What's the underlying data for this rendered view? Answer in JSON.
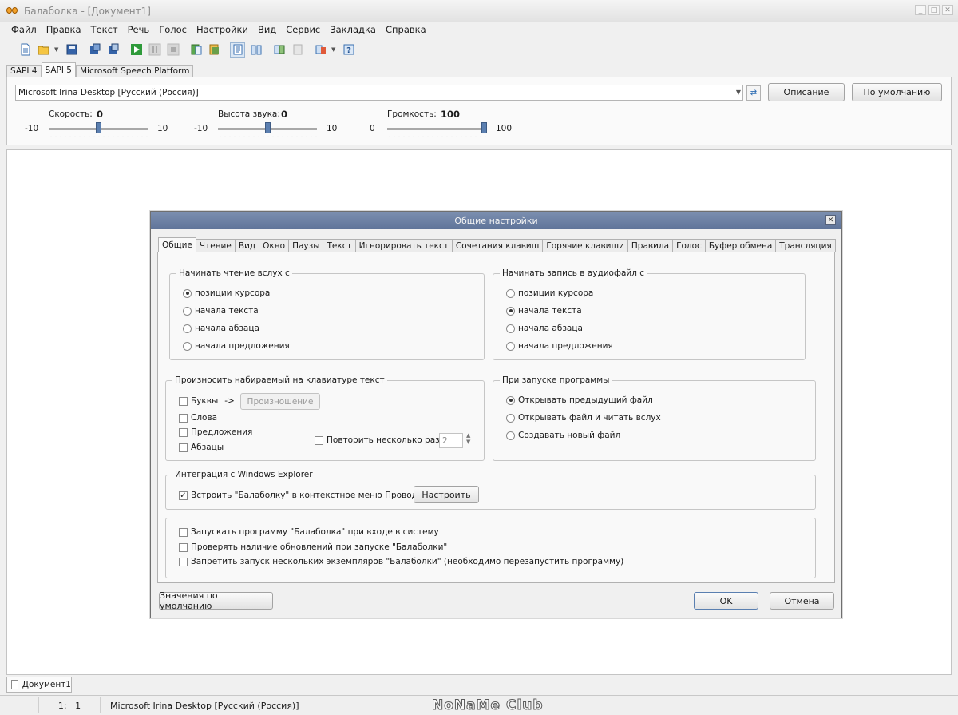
{
  "window": {
    "title": "Балаболка - [Документ1]"
  },
  "menu": [
    "Файл",
    "Правка",
    "Текст",
    "Речь",
    "Голос",
    "Настройки",
    "Вид",
    "Сервис",
    "Закладка",
    "Справка"
  ],
  "sapi_tabs": [
    "SAPI 4",
    "SAPI 5",
    "Microsoft Speech Platform"
  ],
  "voice": {
    "selected": "Microsoft Irina Desktop [Русский (Россия)]",
    "describe_label": "Описание",
    "default_label": "По умолчанию",
    "speed": {
      "label": "Скорость:",
      "value": "0",
      "min": "-10",
      "max": "10",
      "level": 0
    },
    "pitch": {
      "label": "Высота звука:",
      "value": "0",
      "min": "-10",
      "max": "10",
      "level": 0
    },
    "volume": {
      "label": "Громкость:",
      "value": "100",
      "min": "0",
      "max": "100",
      "level": 100
    }
  },
  "dialog": {
    "title": "Общие настройки",
    "tabs": [
      "Общие",
      "Чтение",
      "Вид",
      "Окно",
      "Паузы",
      "Текст",
      "Игнорировать текст",
      "Сочетания клавиш",
      "Горячие клавиши",
      "Правила",
      "Голос",
      "Буфер обмена",
      "Трансляция"
    ],
    "start_reading": {
      "legend": "Начинать чтение вслух с",
      "options": [
        "позиции курсора",
        "начала текста",
        "начала абзаца",
        "начала предложения"
      ],
      "selected": 0
    },
    "start_recording": {
      "legend": "Начинать запись в аудиофайл с",
      "options": [
        "позиции курсора",
        "начала текста",
        "начала абзаца",
        "начала предложения"
      ],
      "selected": 1
    },
    "typed_text": {
      "legend": "Произносить набираемый на клавиатуре текст",
      "letters": "Буквы",
      "arrow": "->",
      "pronunciation_button": "Произношение",
      "words": "Слова",
      "sentences": "Предложения",
      "paragraphs": "Абзацы",
      "repeat_label": "Повторить несколько раз:",
      "repeat_value": "2"
    },
    "on_start": {
      "legend": "При запуске программы",
      "options": [
        "Открывать предыдущий файл",
        "Открывать файл и читать вслух",
        "Создавать новый файл"
      ],
      "selected": 0
    },
    "explorer": {
      "legend": "Интеграция с Windows Explorer",
      "embed_label": "Встроить \"Балаболку\" в контекстное меню Проводника",
      "embed_checked": true,
      "configure_button": "Настроить"
    },
    "misc": [
      "Запускать программу \"Балаболка\" при входе в систему",
      "Проверять наличие обновлений при запуске \"Балаболки\"",
      "Запретить запуск нескольких экземпляров \"Балаболки\" (необходимо перезапустить программу)"
    ],
    "defaults_button": "Значения по умолчанию",
    "ok_button": "OK",
    "cancel_button": "Отмена"
  },
  "document_tab": "Документ1",
  "status": {
    "position": "1:   1",
    "voice": "Microsoft Irina Desktop [Русский (Россия)]",
    "watermark": "NoNaMe Club"
  },
  "colors": {
    "dialog_title_bg": "#6b7fa3",
    "slider_thumb": "#5b7fb0"
  }
}
